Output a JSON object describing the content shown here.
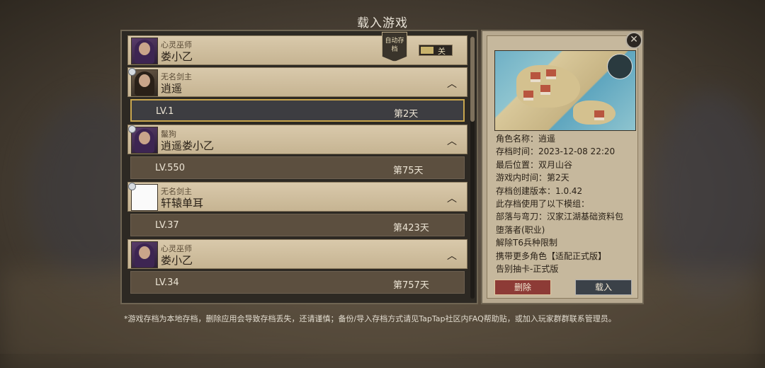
{
  "title": "载入游戏",
  "saves": [
    {
      "class": "心灵巫师",
      "name": "娄小乙",
      "auto_label": "自动存档",
      "toggle_label": "关",
      "pinned": false,
      "portrait": "mage-portrait"
    },
    {
      "class": "无名剑主",
      "name": "逍遥",
      "pinned": true,
      "portrait": "swordsman-portrait",
      "entry": {
        "level": "LV.1",
        "days": "第2天",
        "selected": true
      }
    },
    {
      "class": "鬣狗",
      "name": "逍遥娄小乙",
      "pinned": true,
      "portrait": "mage-portrait",
      "entry": {
        "level": "LV.550",
        "days": "第75天"
      }
    },
    {
      "class": "无名剑主",
      "name": "轩辕单耳",
      "pinned": true,
      "portrait": "blank-portrait",
      "entry": {
        "level": "LV.37",
        "days": "第423天"
      }
    },
    {
      "class": "心灵巫师",
      "name": "娄小乙",
      "pinned": false,
      "portrait": "mage-portrait",
      "entry": {
        "level": "LV.34",
        "days": "第757天"
      }
    }
  ],
  "detail": {
    "lines": [
      "角色名称：逍遥",
      "存档时间：2023-12-08 22:20",
      "最后位置：双月山谷",
      "游戏内时间：第2天",
      "存档创建版本：1.0.42",
      "此存档使用了以下模组：",
      "部落与弯刀：汉家江湖基础资料包",
      "堕落者(职业)",
      "解除T6兵种限制",
      "携带更多角色【适配正式版】",
      "告别抽卡-正式版"
    ],
    "delete_label": "删除",
    "load_label": "载入"
  },
  "close_icon": "close-icon",
  "footnote": "*游戏存档为本地存档，删除应用会导致存档丢失，还请谨慎；备份/导入存档方式请见TapTap社区内FAQ帮助贴，或加入玩家群群联系管理员。",
  "colors": {
    "header_bg": "#d9c9ab",
    "row_bg": "#5c4f3f",
    "selected_border": "#c9a64e",
    "delete_bg": "#8d3b36",
    "load_bg": "#3b4148"
  }
}
